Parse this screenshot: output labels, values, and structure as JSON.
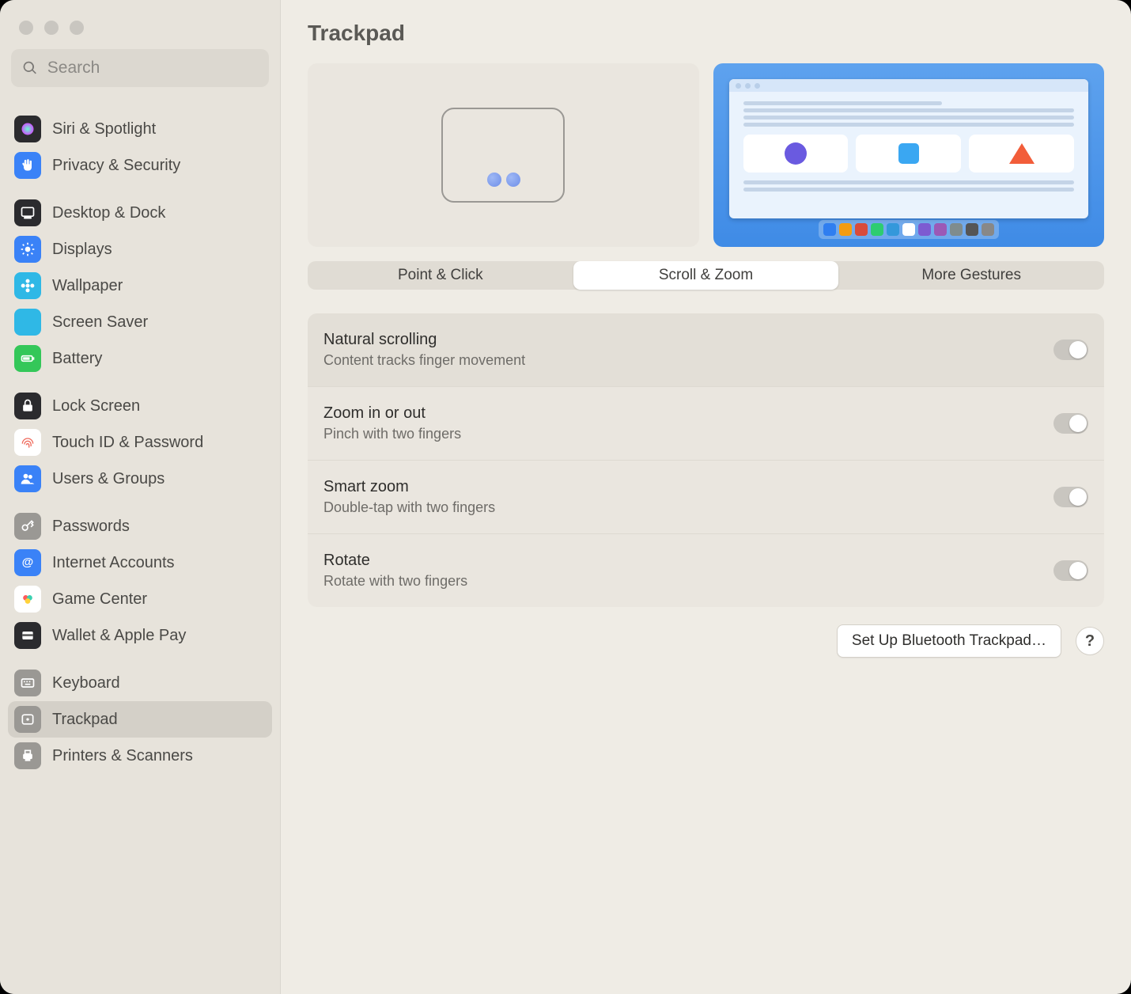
{
  "header": {
    "title": "Trackpad"
  },
  "search": {
    "placeholder": "Search",
    "value": ""
  },
  "sidebar": {
    "groups": [
      {
        "items": [
          {
            "label": "Siri & Spotlight",
            "icon": "siri",
            "bg": "#2b2b2e"
          },
          {
            "label": "Privacy & Security",
            "icon": "hand",
            "bg": "#3a82f7"
          }
        ]
      },
      {
        "items": [
          {
            "label": "Desktop & Dock",
            "icon": "dock",
            "bg": "#2b2b2e"
          },
          {
            "label": "Displays",
            "icon": "sun",
            "bg": "#3a82f7"
          },
          {
            "label": "Wallpaper",
            "icon": "flower",
            "bg": "#2fb8e6"
          },
          {
            "label": "Screen Saver",
            "icon": "moon",
            "bg": "#2fb8e6"
          },
          {
            "label": "Battery",
            "icon": "battery",
            "bg": "#34c759"
          }
        ]
      },
      {
        "items": [
          {
            "label": "Lock Screen",
            "icon": "lock",
            "bg": "#2b2b2e"
          },
          {
            "label": "Touch ID & Password",
            "icon": "finger",
            "bg": "#ffffff"
          },
          {
            "label": "Users & Groups",
            "icon": "users",
            "bg": "#3a82f7"
          }
        ]
      },
      {
        "items": [
          {
            "label": "Passwords",
            "icon": "key",
            "bg": "#9a9894"
          },
          {
            "label": "Internet Accounts",
            "icon": "@",
            "bg": "#3a82f7"
          },
          {
            "label": "Game Center",
            "icon": "gc",
            "bg": "#ffffff"
          },
          {
            "label": "Wallet & Apple Pay",
            "icon": "wallet",
            "bg": "#2b2b2e"
          }
        ]
      },
      {
        "items": [
          {
            "label": "Keyboard",
            "icon": "keyboard",
            "bg": "#9a9894"
          },
          {
            "label": "Trackpad",
            "icon": "trackpad",
            "bg": "#9a9894",
            "selected": true
          },
          {
            "label": "Printers & Scanners",
            "icon": "printer",
            "bg": "#9a9894"
          }
        ]
      }
    ]
  },
  "tabs": {
    "items": [
      {
        "label": "Point & Click",
        "active": false
      },
      {
        "label": "Scroll & Zoom",
        "active": true
      },
      {
        "label": "More Gestures",
        "active": false
      }
    ]
  },
  "settings": [
    {
      "title": "Natural scrolling",
      "subtitle": "Content tracks finger movement",
      "on": false,
      "highlight": true
    },
    {
      "title": "Zoom in or out",
      "subtitle": "Pinch with two fingers",
      "on": false
    },
    {
      "title": "Smart zoom",
      "subtitle": "Double-tap with two fingers",
      "on": false
    },
    {
      "title": "Rotate",
      "subtitle": "Rotate with two fingers",
      "on": false
    }
  ],
  "footer": {
    "setup_button": "Set Up Bluetooth Trackpad…",
    "help": "?"
  },
  "dock_colors": [
    "#2f7ef0",
    "#f39c12",
    "#d94b3b",
    "#2ecc71",
    "#3498db",
    "#ffffff",
    "#7d5bd1",
    "#9b59b6",
    "#7f8c8d",
    "#555555",
    "#888888"
  ]
}
